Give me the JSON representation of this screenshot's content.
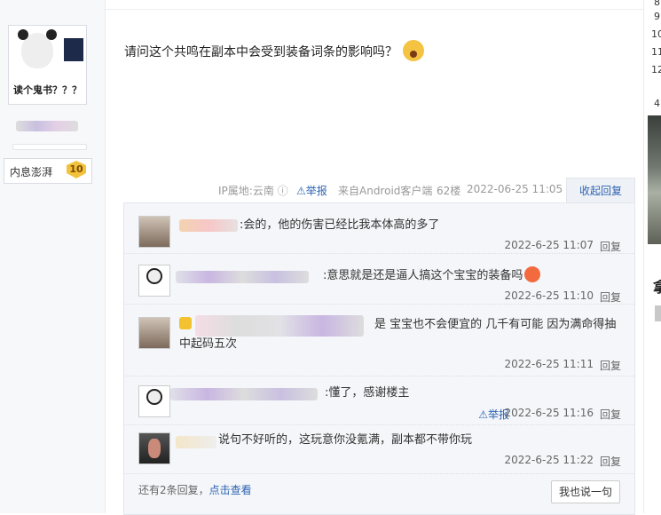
{
  "author": {
    "avatar_caption": "读个鬼书？？？",
    "rank_label": "内息澎湃",
    "rank_level": "10"
  },
  "post": {
    "text": "请问这个共鸣在副本中会受到装备词条的影响吗？",
    "ip": "IP属地:云南",
    "report": "举报",
    "source": "来自Android客户端",
    "floor": "62楼",
    "datetime": "2022-06-25 11:05",
    "collapse": "收起回复"
  },
  "replies": [
    {
      "text": ":会的，他的伤害已经比我本体高的多了",
      "date": "2022-6-25 11:07",
      "reply": "回复"
    },
    {
      "text": ":意思就是还是逼人搞这个宝宝的装备吗",
      "date": "2022-6-25 11:10",
      "reply": "回复"
    },
    {
      "text": "是 宝宝也不会便宜的 几千有可能 因为满命得抽",
      "text2": "中起码五次",
      "date": "2022-6-25 11:11",
      "reply": "回复"
    },
    {
      "text": ":懂了，感谢楼主",
      "date": "2022-6-25 11:16",
      "report": "举报",
      "reply": "回复"
    },
    {
      "text": "说句不好听的，这玩意你没氪满，副本都不带你玩",
      "date": "2022-6-25 11:22",
      "reply": "回复"
    }
  ],
  "more": {
    "text": "还有2条回复，",
    "link": "点击查看"
  },
  "say_button": "我也说一句",
  "right_col": {
    "nums": [
      "8",
      "9",
      "10",
      "11",
      "12",
      "4"
    ],
    "word": "拿"
  },
  "colors": {
    "link": "#2d64b3",
    "badge": "#f3c23c"
  },
  "icons": [
    "scream-emoji",
    "question-icon",
    "warning-icon",
    "angry-emoji",
    "crown-icon"
  ]
}
